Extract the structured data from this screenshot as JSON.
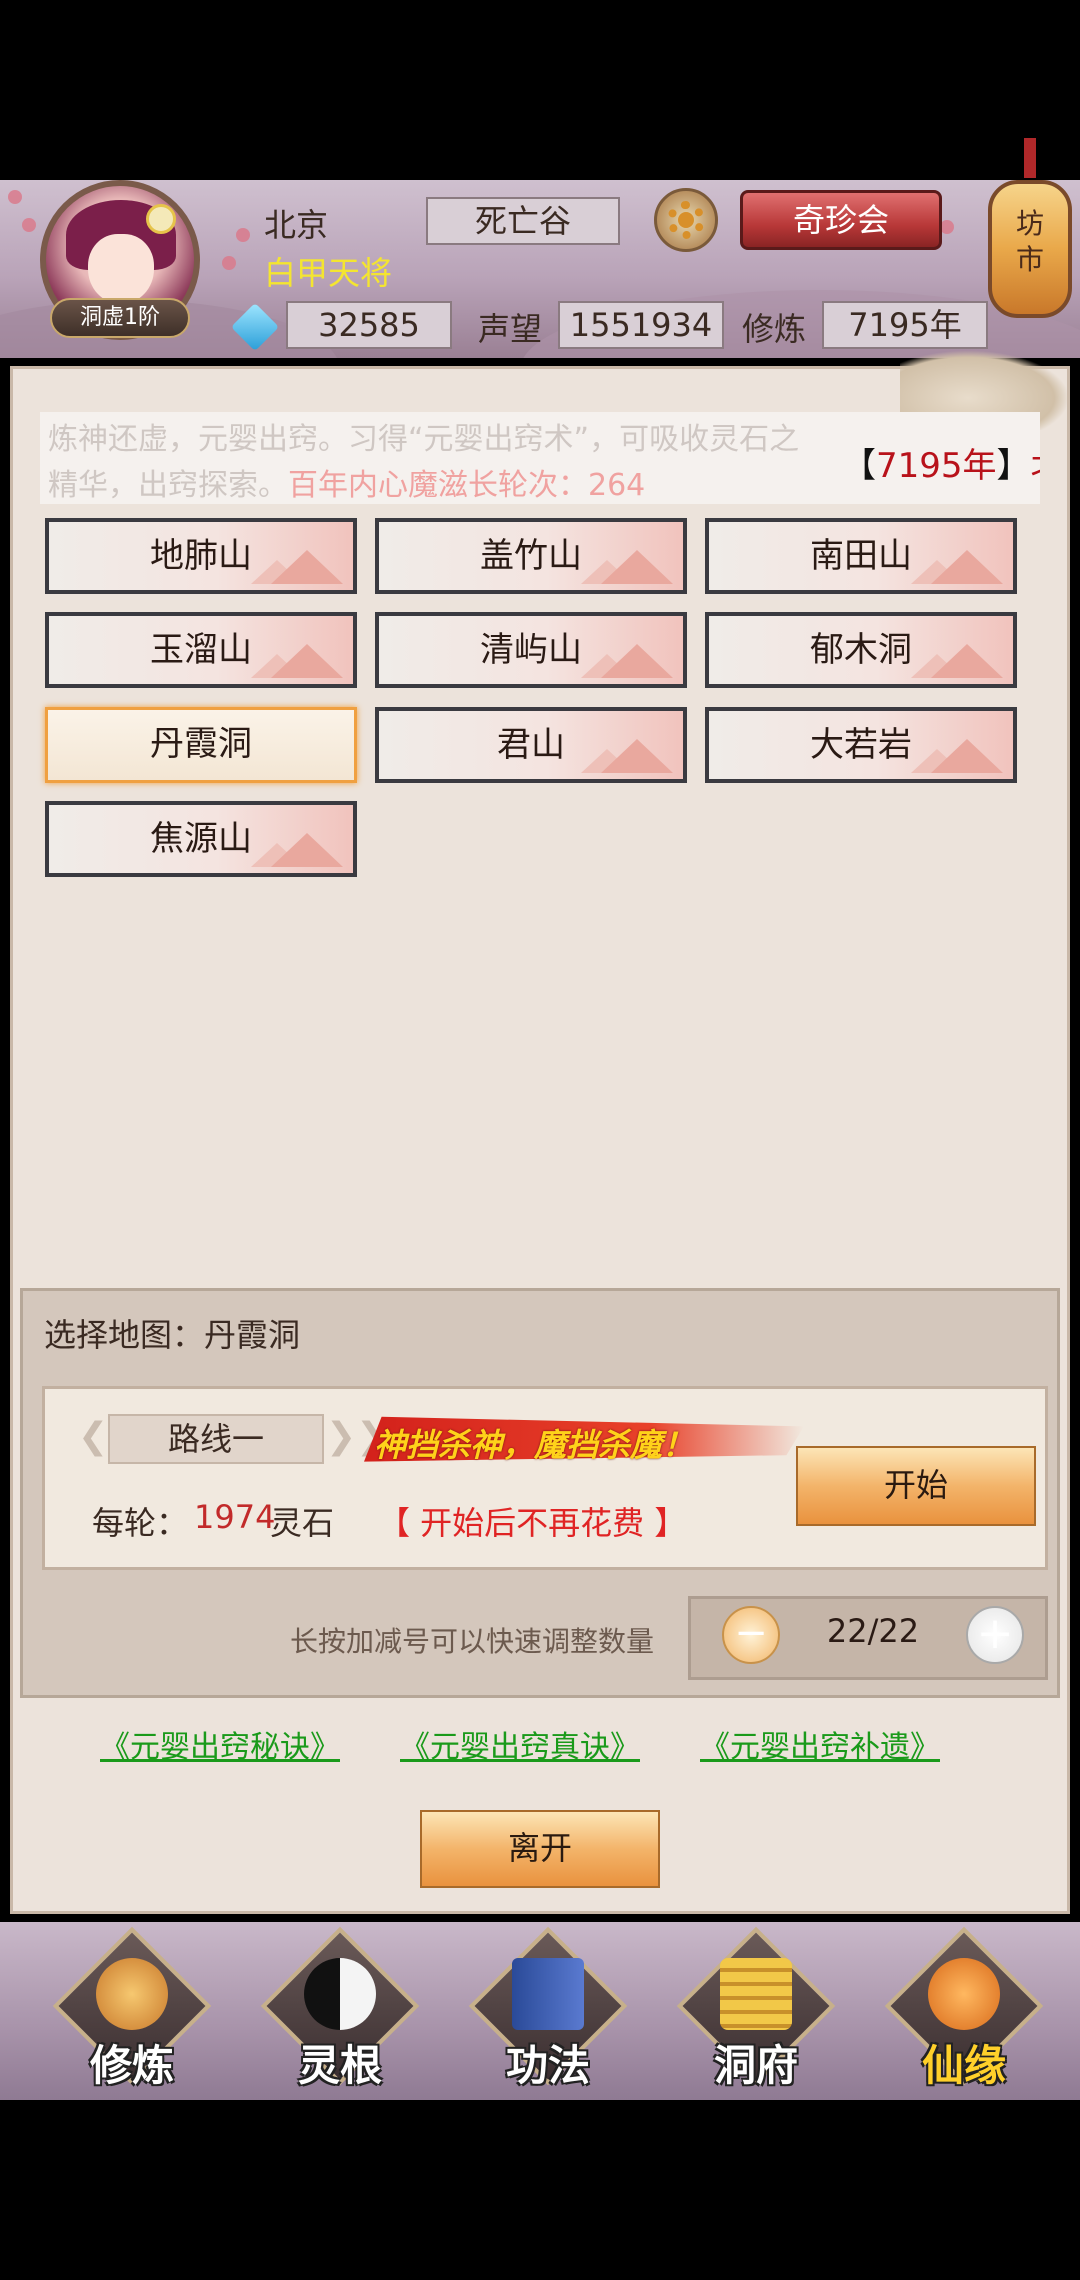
{
  "header": {
    "player_name": "北京",
    "player_title": "白甲天将",
    "rank_badge": "洞虚1阶",
    "location": "死亡谷",
    "treasure_button": "奇珍会",
    "lantern_text": "坊\n市",
    "spirit_stones": "32585",
    "reputation_label": "声望",
    "reputation": "1551934",
    "cultivation_label": "修炼",
    "cultivation": "7195年"
  },
  "intro": {
    "line1": "炼神还虚，元婴出窍。习得“元婴出窍术”，可吸收灵石之",
    "line2_prefix": "精华，出窍探索。",
    "line2_highlight": "百年内心魔滋长轮次：264",
    "ticker_open": "【",
    "ticker_year": "7195年",
    "ticker_close": "】",
    "ticker_name": "北京"
  },
  "maps": [
    {
      "label": "地肺山",
      "selected": false
    },
    {
      "label": "盖竹山",
      "selected": false
    },
    {
      "label": "南田山",
      "selected": false
    },
    {
      "label": "玉溜山",
      "selected": false
    },
    {
      "label": "清屿山",
      "selected": false
    },
    {
      "label": "郁木洞",
      "selected": false
    },
    {
      "label": "丹霞洞",
      "selected": true
    },
    {
      "label": "君山",
      "selected": false
    },
    {
      "label": "大若岩",
      "selected": false
    },
    {
      "label": "焦源山",
      "selected": false
    }
  ],
  "route": {
    "selected_map_label": "选择地图：丹霞洞",
    "route_tab": "路线一",
    "slogan": "神挡杀神，魔挡杀魔！",
    "cost_label": "每轮：",
    "cost_value": "1974",
    "cost_unit": "灵石",
    "cost_note": "【 开始后不再花费 】",
    "start_button": "开始",
    "hint": "长按加减号可以快速调整数量",
    "count": "22/22",
    "minus": "−",
    "plus": "+"
  },
  "guides": [
    "《元婴出窍秘诀》",
    "《元婴出窍真诀》",
    "《元婴出窍补遗》"
  ],
  "leave_button": "离开",
  "nav": [
    {
      "label": "修炼",
      "icon": "cultivation-icon",
      "color": "#e8a030"
    },
    {
      "label": "灵根",
      "icon": "spirit-root-icon",
      "color": "#2a2a2a"
    },
    {
      "label": "功法",
      "icon": "technique-book-icon",
      "color": "#3a5aa8"
    },
    {
      "label": "洞府",
      "icon": "cave-mansion-icon",
      "color": "#e0b030"
    },
    {
      "label": "仙缘",
      "icon": "gourd-icon",
      "color": "#e88a2a"
    }
  ],
  "colors": {
    "accent_red": "#c22a2a",
    "link_green": "#1a9a1a",
    "title_yellow": "#f4e530"
  }
}
